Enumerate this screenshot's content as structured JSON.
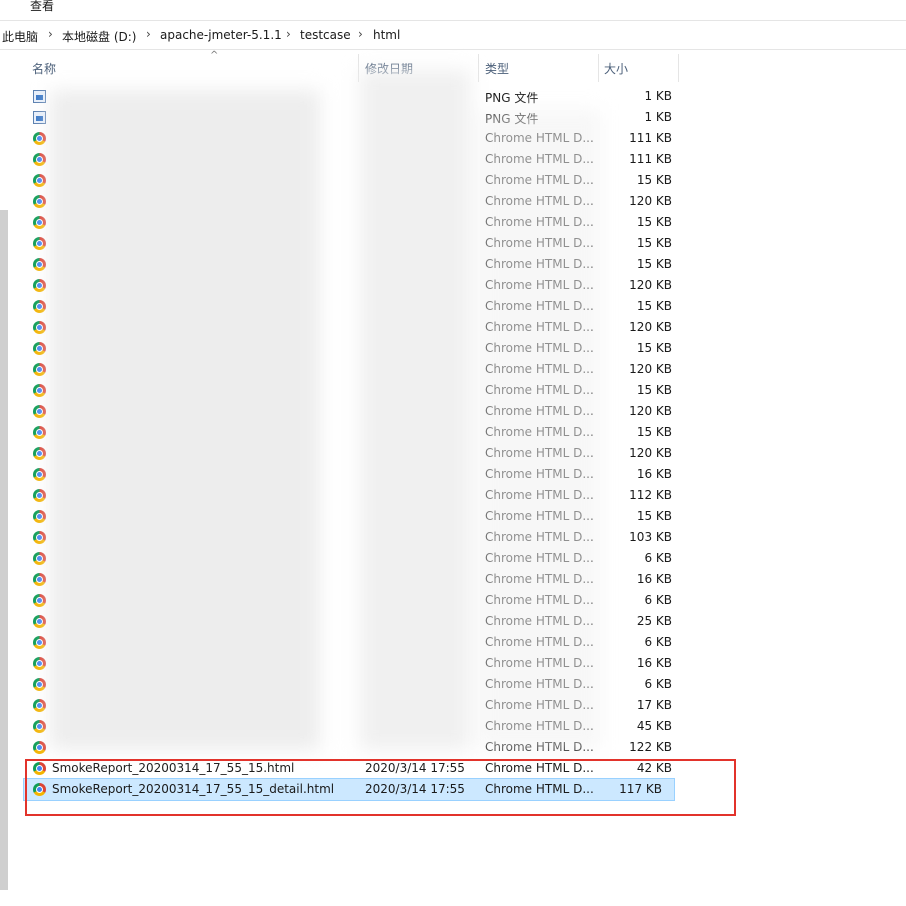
{
  "menu": {
    "view_label": "查看"
  },
  "breadcrumb": [
    "此电脑",
    "本地磁盘 (D:)",
    "apache-jmeter-5.1.1",
    "testcase",
    "html"
  ],
  "columns": {
    "name": "名称",
    "date": "修改日期",
    "type": "类型",
    "size": "大小"
  },
  "rows": [
    {
      "icon": "png-file-icon",
      "name": "",
      "date": "",
      "type": "PNG 文件",
      "size": "1 KB"
    },
    {
      "icon": "png-file-icon",
      "name": "",
      "date": "",
      "type": "PNG 文件",
      "size": "1 KB"
    },
    {
      "icon": "chrome-icon",
      "name": "",
      "date": "",
      "type": "Chrome HTML D...",
      "size": "111 KB"
    },
    {
      "icon": "chrome-icon",
      "name": "",
      "date": "",
      "type": "Chrome HTML D...",
      "size": "111 KB"
    },
    {
      "icon": "chrome-icon",
      "name": "",
      "date": "",
      "type": "Chrome HTML D...",
      "size": "15 KB"
    },
    {
      "icon": "chrome-icon",
      "name": "",
      "date": "",
      "type": "Chrome HTML D...",
      "size": "120 KB"
    },
    {
      "icon": "chrome-icon",
      "name": "",
      "date": "",
      "type": "Chrome HTML D...",
      "size": "15 KB"
    },
    {
      "icon": "chrome-icon",
      "name": "",
      "date": "",
      "type": "Chrome HTML D...",
      "size": "15 KB"
    },
    {
      "icon": "chrome-icon",
      "name": "",
      "date": "",
      "type": "Chrome HTML D...",
      "size": "15 KB"
    },
    {
      "icon": "chrome-icon",
      "name": "",
      "date": "",
      "type": "Chrome HTML D...",
      "size": "120 KB"
    },
    {
      "icon": "chrome-icon",
      "name": "",
      "date": "",
      "type": "Chrome HTML D...",
      "size": "15 KB"
    },
    {
      "icon": "chrome-icon",
      "name": "",
      "date": "",
      "type": "Chrome HTML D...",
      "size": "120 KB"
    },
    {
      "icon": "chrome-icon",
      "name": "",
      "date": "",
      "type": "Chrome HTML D...",
      "size": "15 KB"
    },
    {
      "icon": "chrome-icon",
      "name": "",
      "date": "",
      "type": "Chrome HTML D...",
      "size": "120 KB"
    },
    {
      "icon": "chrome-icon",
      "name": "",
      "date": "",
      "type": "Chrome HTML D...",
      "size": "15 KB"
    },
    {
      "icon": "chrome-icon",
      "name": "",
      "date": "",
      "type": "Chrome HTML D...",
      "size": "120 KB"
    },
    {
      "icon": "chrome-icon",
      "name": "",
      "date": "",
      "type": "Chrome HTML D...",
      "size": "15 KB"
    },
    {
      "icon": "chrome-icon",
      "name": "",
      "date": "",
      "type": "Chrome HTML D...",
      "size": "120 KB"
    },
    {
      "icon": "chrome-icon",
      "name": "",
      "date": "",
      "type": "Chrome HTML D...",
      "size": "16 KB"
    },
    {
      "icon": "chrome-icon",
      "name": "",
      "date": "",
      "type": "Chrome HTML D...",
      "size": "112 KB"
    },
    {
      "icon": "chrome-icon",
      "name": "",
      "date": "",
      "type": "Chrome HTML D...",
      "size": "15 KB"
    },
    {
      "icon": "chrome-icon",
      "name": "",
      "date": "",
      "type": "Chrome HTML D...",
      "size": "103 KB"
    },
    {
      "icon": "chrome-icon",
      "name": "",
      "date": "",
      "type": "Chrome HTML D...",
      "size": "6 KB"
    },
    {
      "icon": "chrome-icon",
      "name": "",
      "date": "",
      "type": "Chrome HTML D...",
      "size": "16 KB"
    },
    {
      "icon": "chrome-icon",
      "name": "",
      "date": "",
      "type": "Chrome HTML D...",
      "size": "6 KB"
    },
    {
      "icon": "chrome-icon",
      "name": "",
      "date": "",
      "type": "Chrome HTML D...",
      "size": "25 KB"
    },
    {
      "icon": "chrome-icon",
      "name": "",
      "date": "",
      "type": "Chrome HTML D...",
      "size": "6 KB"
    },
    {
      "icon": "chrome-icon",
      "name": "",
      "date": "",
      "type": "Chrome HTML D...",
      "size": "16 KB"
    },
    {
      "icon": "chrome-icon",
      "name": "",
      "date": "",
      "type": "Chrome HTML D...",
      "size": "6 KB"
    },
    {
      "icon": "chrome-icon",
      "name": "",
      "date": "",
      "type": "Chrome HTML D...",
      "size": "17 KB"
    },
    {
      "icon": "chrome-icon",
      "name": "",
      "date": "",
      "type": "Chrome HTML D...",
      "size": "45 KB"
    },
    {
      "icon": "chrome-icon",
      "name": "",
      "date": "",
      "type": "Chrome HTML D...",
      "size": "122 KB"
    },
    {
      "icon": "chrome-icon",
      "name": "SmokeReport_20200314_17_55_15.html",
      "date": "2020/3/14 17:55",
      "type": "Chrome HTML D...",
      "size": "42 KB",
      "highlighted": true
    },
    {
      "icon": "chrome-icon",
      "name": "SmokeReport_20200314_17_55_15_detail.html",
      "date": "2020/3/14 17:55",
      "type": "Chrome HTML D...",
      "size": "117 KB",
      "highlighted": true,
      "selected": true
    }
  ],
  "colors": {
    "selection_bg": "#cce8ff",
    "highlight_box": "#e2332b",
    "header_text": "#4c607a"
  }
}
